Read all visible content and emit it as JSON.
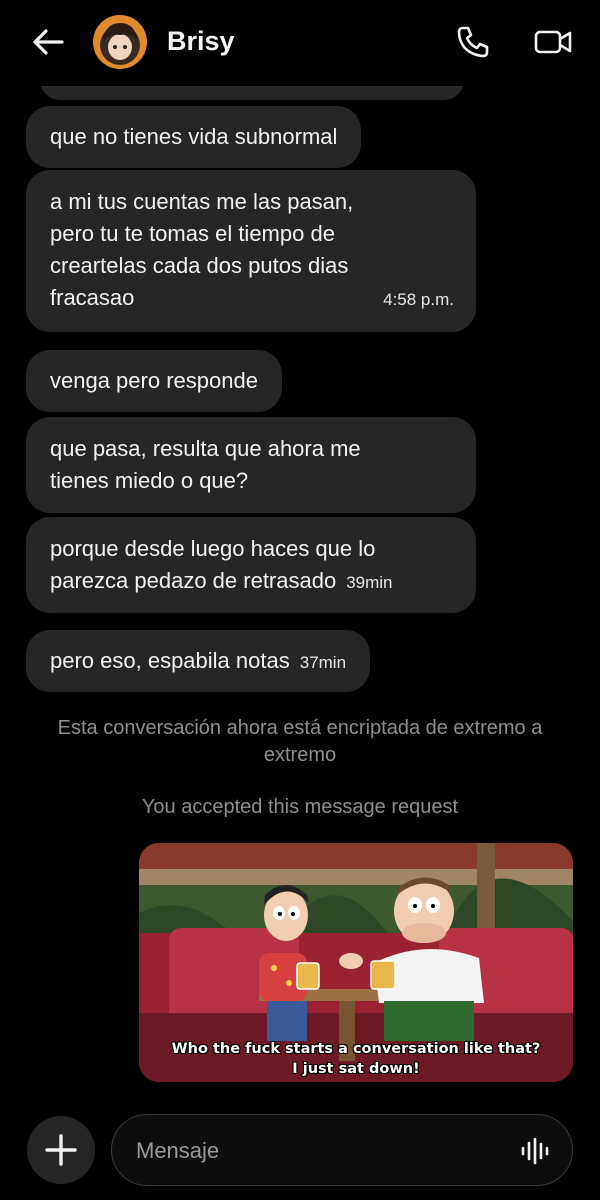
{
  "header": {
    "contact_name": "Brisy",
    "icons": [
      "arrow-left-icon",
      "phone-icon",
      "video-camera-icon"
    ]
  },
  "messages": [
    {
      "text": "que no tienes vida subnormal",
      "time": ""
    },
    {
      "lines": [
        "a mi tus cuentas me las pasan,",
        "pero tu te tomas el tiempo de",
        "creartelas cada dos putos dias",
        "fracasao"
      ],
      "time": "4:58 p.m."
    },
    {
      "text": "venga pero responde",
      "time": ""
    },
    {
      "lines": [
        "que pasa, resulta que ahora me",
        "tienes miedo o que?"
      ],
      "time": ""
    },
    {
      "lines": [
        "porque desde luego haces que lo",
        "parezca pedazo de retrasado"
      ],
      "time": "39min"
    },
    {
      "text": "pero eso, espabila notas",
      "time": "37min"
    }
  ],
  "system": {
    "encrypted_notice": "Esta conversación ahora está encriptada de extremo a extremo",
    "request_notice": "You accepted this message request"
  },
  "image_message": {
    "subtitle_line1": "Who the fuck starts a conversation like that?",
    "subtitle_line2": "I just sat down!"
  },
  "composer": {
    "placeholder": "Mensaje",
    "icons": [
      "plus-icon",
      "voice-wave-icon"
    ]
  },
  "colors": {
    "background": "#000000",
    "bubble": "#262626",
    "muted_text": "#8f8f8f"
  }
}
